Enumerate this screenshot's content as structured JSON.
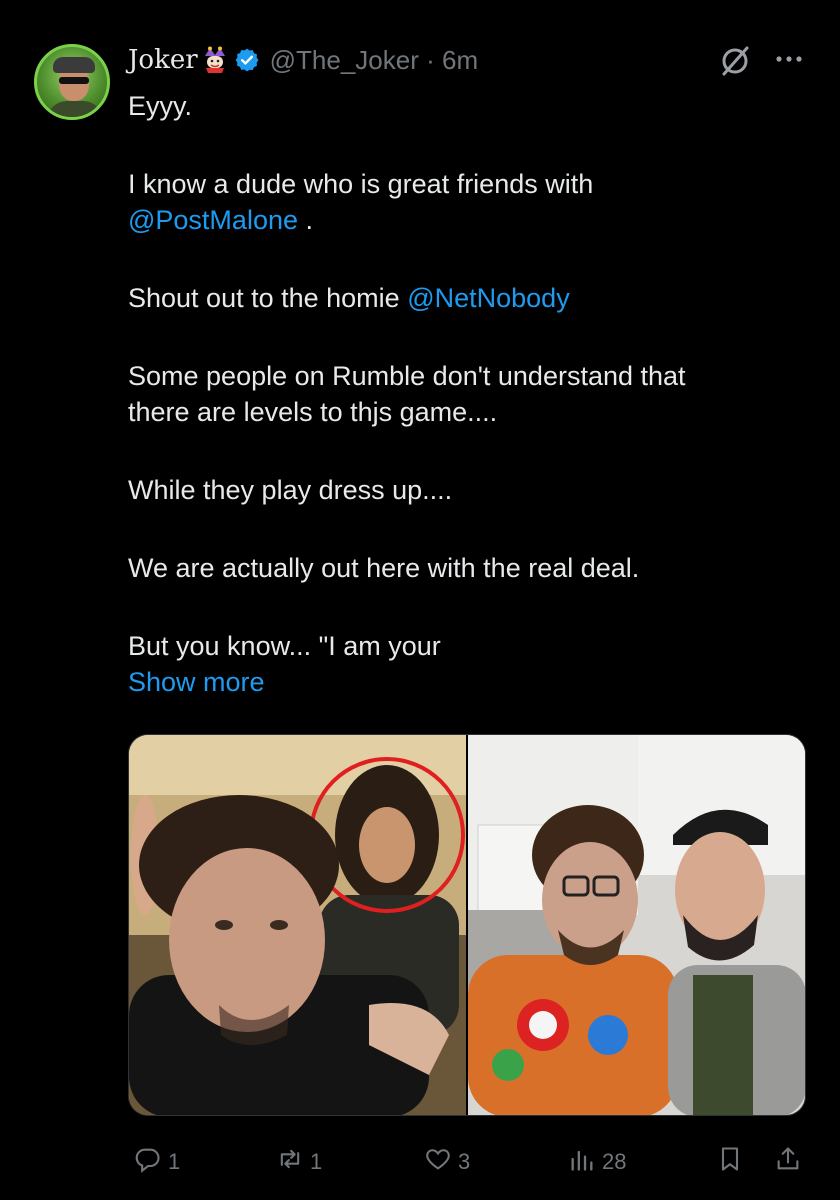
{
  "post": {
    "author_name": "Joker",
    "handle": "@The_Joker",
    "separator": "·",
    "time": "6m",
    "lines": {
      "l1": "Eyyy.",
      "l2": "I know a dude who is great friends with",
      "l3_mention": "@PostMalone",
      "l3_after": " .",
      "l4_before": "Shout out to the homie ",
      "l4_mention": "@NetNobody",
      "l5": "Some people on Rumble don't understand that",
      "l6": "there are levels to thjs game....",
      "l7": "While they play dress up....",
      "l8": "We are actually out here with the real deal.",
      "l9": "But you know... \"I am your"
    },
    "show_more": "Show more"
  },
  "actions": {
    "replies": "1",
    "reposts": "1",
    "likes": "3",
    "views": "28"
  },
  "icons": {
    "verified": "verified-badge-icon",
    "grok": "grok-icon",
    "more": "more-icon",
    "reply": "reply-icon",
    "repost": "repost-icon",
    "like": "heart-icon",
    "views": "views-icon",
    "bookmark": "bookmark-icon",
    "share": "share-icon"
  },
  "colors": {
    "background": "#000000",
    "text": "#e7e9ea",
    "secondary": "#71767b",
    "link": "#1d9bf0",
    "verified": "#1d9bf0",
    "highlight_circle": "#e02020"
  }
}
